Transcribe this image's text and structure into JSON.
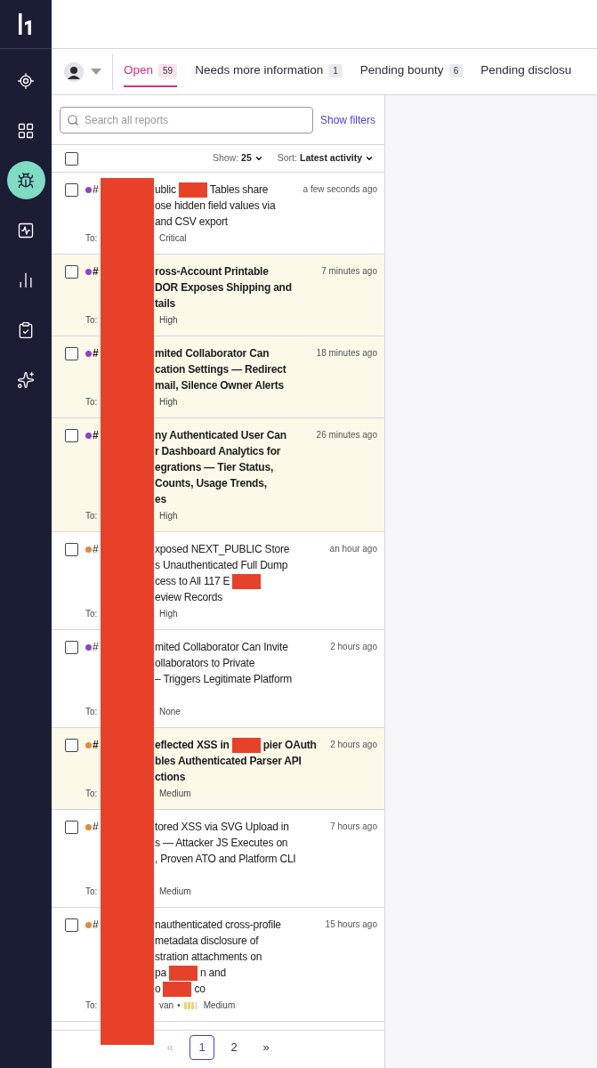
{
  "sidebar": {
    "items": [
      {
        "selected": false
      },
      {
        "selected": false
      },
      {
        "selected": true
      },
      {
        "selected": false
      },
      {
        "selected": false
      },
      {
        "selected": false
      },
      {
        "selected": false
      }
    ]
  },
  "tabs": [
    {
      "label": "Open",
      "count": "59",
      "selected": true
    },
    {
      "label": "Needs more information",
      "count": "1",
      "selected": false
    },
    {
      "label": "Pending bounty",
      "count": "6",
      "selected": false
    },
    {
      "label": "Pending disclosu",
      "selected": false
    }
  ],
  "search": {
    "placeholder": "Search all reports"
  },
  "filters_link": "Show filters",
  "list_controls": {
    "select_all_checked": false,
    "show_label": "Show:",
    "show_value": "25",
    "sort_label": "Sort:",
    "sort_value": "Latest activity"
  },
  "reports": [
    {
      "checked": false,
      "unread": false,
      "color": "#8e44c2",
      "number": "#",
      "time": "a few seconds ago",
      "lines": [
        {
          "parts": [
            {
              "text": "ublic"
            },
            {
              "kind": "redaction"
            },
            {
              "text": "Tables share"
            }
          ]
        },
        {
          "parts": [
            {
              "text": "ose hidden field values via"
            }
          ]
        },
        {
          "parts": [
            {
              "text": "and CSV export"
            }
          ]
        }
      ],
      "meta": {
        "lead": "To:",
        "severity": "Critical"
      }
    },
    {
      "checked": false,
      "unread": true,
      "color": "#8e44c2",
      "number": "#",
      "time": "7 minutes ago",
      "lines": [
        {
          "parts": [
            {
              "text": "ross-Account Printable"
            }
          ]
        },
        {
          "parts": [
            {
              "text": "DOR Exposes Shipping and"
            }
          ]
        },
        {
          "parts": [
            {
              "text": "tails"
            }
          ]
        }
      ],
      "meta": {
        "lead": "To:",
        "severity": "High"
      }
    },
    {
      "checked": false,
      "unread": true,
      "color": "#8e44c2",
      "number": "#",
      "time": "18 minutes ago",
      "lines": [
        {
          "parts": [
            {
              "text": "mited Collaborator Can"
            }
          ]
        },
        {
          "parts": [
            {
              "text": "cation Settings — Redirect"
            }
          ]
        },
        {
          "parts": [
            {
              "text": "mail, Silence Owner Alerts"
            }
          ]
        }
      ],
      "meta": {
        "lead": "To:",
        "severity": "High"
      }
    },
    {
      "checked": false,
      "unread": true,
      "color": "#8e44c2",
      "number": "#",
      "time": "26 minutes ago",
      "lines": [
        {
          "parts": [
            {
              "text": "ny Authenticated User Can"
            }
          ]
        },
        {
          "parts": [
            {
              "text": "r Dashboard Analytics for"
            }
          ]
        },
        {
          "parts": [
            {
              "text": "egrations — Tier Status,"
            }
          ]
        },
        {
          "parts": [
            {
              "text": "Counts, Usage Trends,"
            }
          ]
        },
        {
          "parts": [
            {
              "text": "es"
            }
          ]
        }
      ],
      "meta": {
        "lead": "To:",
        "severity": "High"
      }
    },
    {
      "checked": false,
      "unread": false,
      "color": "#e08a3c",
      "number": "#",
      "time": "an hour ago",
      "lines": [
        {
          "parts": [
            {
              "text": "xposed NEXT_PUBLIC Store"
            }
          ]
        },
        {
          "parts": [
            {
              "text": "s Unauthenticated Full Dump"
            }
          ]
        },
        {
          "parts": [
            {
              "text": "cess to All 117 E"
            },
            {
              "kind": "redaction"
            }
          ]
        },
        {
          "parts": [
            {
              "text": "eview Records"
            }
          ]
        }
      ],
      "meta": {
        "lead": "To:",
        "severity": "High"
      }
    },
    {
      "checked": false,
      "unread": false,
      "color": "#8e44c2",
      "number": "#",
      "time": "2 hours ago",
      "lines": [
        {
          "parts": [
            {
              "text": "mited Collaborator Can Invite"
            }
          ]
        },
        {
          "parts": [
            {
              "text": "ollaborators to Private"
            }
          ]
        },
        {
          "parts": [
            {
              "text": "– Triggers Legitimate Platform"
            }
          ]
        },
        {
          "kind": "covered"
        }
      ],
      "meta": {
        "lead": "To:",
        "severity": "None"
      }
    },
    {
      "checked": false,
      "unread": true,
      "color": "#e08a3c",
      "number": "#",
      "time": "2 hours ago",
      "lines": [
        {
          "parts": [
            {
              "text": "eflected XSS in"
            },
            {
              "kind": "redaction"
            },
            {
              "text": "pier OAuth"
            }
          ]
        },
        {
          "parts": [
            {
              "text": "bles Authenticated Parser API"
            }
          ]
        },
        {
          "parts": [
            {
              "text": "ctions"
            }
          ]
        }
      ],
      "meta": {
        "lead": "To:",
        "severity": "Medium"
      }
    },
    {
      "checked": false,
      "unread": false,
      "color": "#e08a3c",
      "number": "#",
      "time": "7 hours ago",
      "lines": [
        {
          "parts": [
            {
              "text": "tored XSS via SVG Upload in"
            }
          ]
        },
        {
          "parts": [
            {
              "text": "s — Attacker JS Executes on"
            }
          ]
        },
        {
          "parts": [
            {
              "text": ", Proven ATO and Platform CLI"
            }
          ]
        },
        {
          "kind": "covered"
        }
      ],
      "meta": {
        "lead": "To:",
        "severity": "Medium"
      }
    },
    {
      "checked": false,
      "unread": false,
      "color": "#e08a3c",
      "number": "#",
      "time": "15 hours ago",
      "lines": [
        {
          "parts": [
            {
              "text": "nauthenticated cross-profile"
            }
          ]
        },
        {
          "parts": [
            {
              "text": "metadata disclosure of"
            }
          ]
        },
        {
          "parts": [
            {
              "text": "stration attachments on"
            }
          ]
        },
        {
          "parts": [
            {
              "text": "pa"
            },
            {
              "kind": "redaction"
            },
            {
              "text": "n and"
            }
          ]
        },
        {
          "parts": [
            {
              "text": "o"
            },
            {
              "kind": "redaction"
            },
            {
              "text": "co"
            }
          ]
        }
      ],
      "meta": {
        "lead": "To:",
        "assignee": "van",
        "separator": "•",
        "severity_bars": true,
        "severity": "Medium"
      }
    }
  ],
  "pagination": [
    {
      "label": "«",
      "disabled": true,
      "selected": false
    },
    {
      "label": "1",
      "selected": true
    },
    {
      "label": "2",
      "selected": false
    },
    {
      "label": "»",
      "disabled": false,
      "selected": false
    }
  ]
}
